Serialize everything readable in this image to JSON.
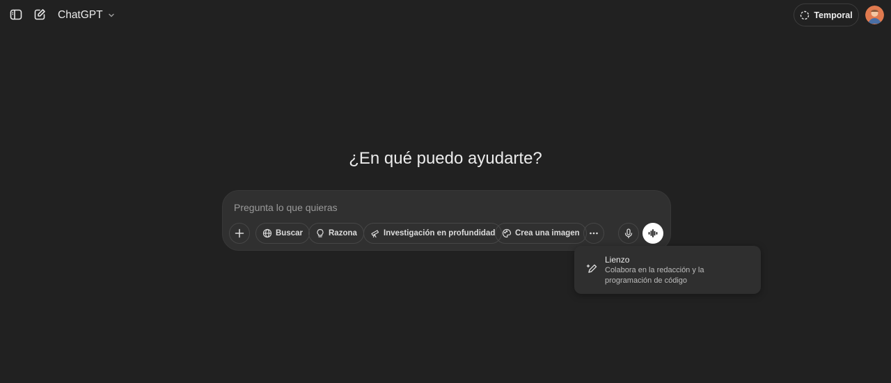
{
  "header": {
    "model_name": "ChatGPT",
    "temporal_label": "Temporal",
    "icons": {
      "sidebar": "sidebar-toggle-icon",
      "new_chat": "new-chat-icon",
      "model_dropdown": "chevron-down-icon",
      "temporal": "temporary-chat-icon"
    }
  },
  "main": {
    "heading": "¿En qué puedo ayudarte?"
  },
  "composer": {
    "placeholder": "Pregunta lo que quieras",
    "tools": {
      "search": "Buscar",
      "reason": "Razona",
      "deep_research": "Investigación en profundidad",
      "create_image": "Crea una imagen"
    },
    "icons": [
      "plus-icon",
      "globe-icon",
      "lightbulb-icon",
      "telescope-icon",
      "palette-icon",
      "more-icon",
      "microphone-icon",
      "voice-mode-icon"
    ]
  },
  "tooltip": {
    "title": "Lienzo",
    "description": "Colabora en la redacción y la programación de código"
  },
  "colors": {
    "background": "#212121",
    "composer": "#303030",
    "tooltip": "#2f2f2f",
    "voice_button": "#ffffff"
  }
}
